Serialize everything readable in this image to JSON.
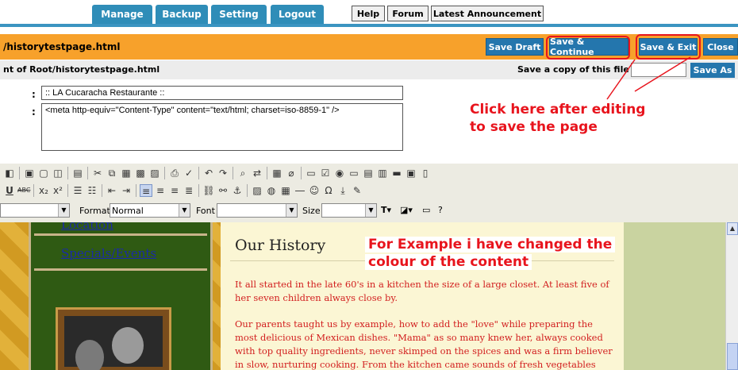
{
  "nav": {
    "manage": "Manage",
    "backup": "Backup",
    "setting": "Setting",
    "logout": "Logout",
    "help": "Help",
    "forum": "Forum",
    "latest": "Latest Announcement"
  },
  "editor_bar": {
    "filename": "/historytestpage.html",
    "save_draft": "Save Draft",
    "save_continue": "Save & Continue",
    "save_exit": "Save & Exit",
    "close": "Close"
  },
  "path_row": {
    "path": "nt of Root/historytestpage.html",
    "copy_label": "Save a copy of this file as",
    "copy_value": "",
    "save_as": "Save As"
  },
  "form": {
    "title_value": ":: LA Cucaracha Restaurante ::",
    "meta_value": "<meta http-equiv=\"Content-Type\" content=\"text/html; charset=iso-8859-1\" />"
  },
  "annotations": {
    "click_here_1": "Click here after editing",
    "click_here_2": "to save the page",
    "example_1": "For Example i have changed the",
    "example_2": "colour of the content"
  },
  "toolbar": {
    "format_label": "Format",
    "format_value": "Normal",
    "font_label": "Font",
    "font_value": "",
    "size_label": "Size",
    "size_value": ""
  },
  "content": {
    "side_link_location": "Location",
    "side_link_specials": "Specials/Events",
    "heading": "Our History",
    "para1": "It all started in the late 60's in a kitchen the size of a large closet. At least five of her seven children always close by.",
    "para2": "Our parents taught us by example, how to add the \"love\" while preparing the most delicious of Mexican dishes. \"Mama\" as so many knew her, always cooked with top quality ingredients, never skimped on the spices and was a firm believer in slow, nurturing cooking. From the kitchen came sounds of fresh vegetables being cleaned"
  },
  "colors": {
    "nav_blue": "#2f8db8",
    "title_orange": "#f7a12b",
    "annotation_red": "#e8141d",
    "content_red": "#d22020"
  }
}
